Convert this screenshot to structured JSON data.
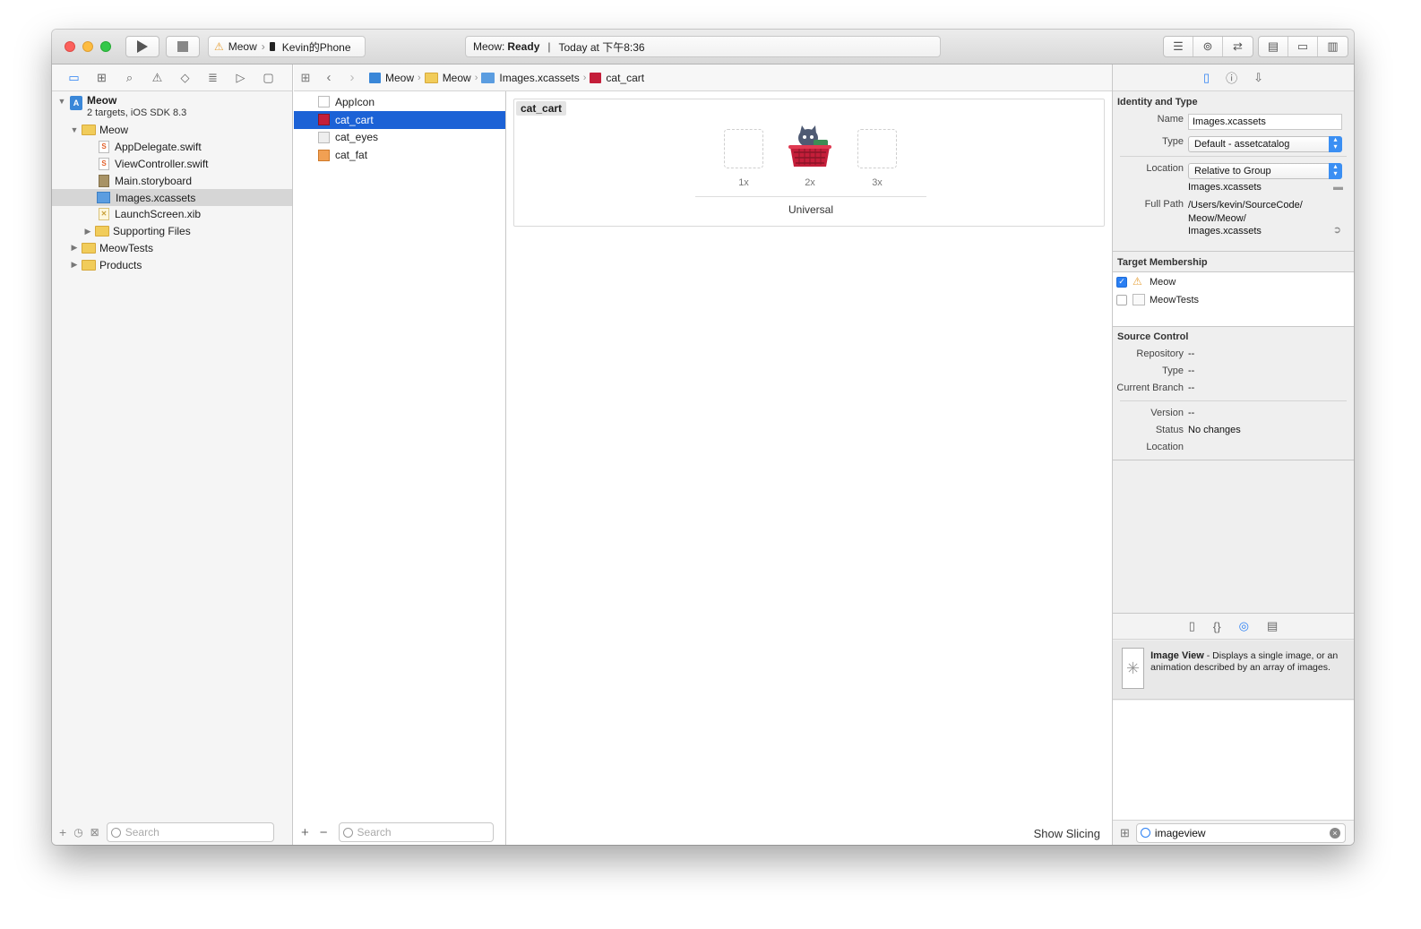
{
  "toolbar": {
    "scheme_target": "Meow",
    "scheme_device": "Kevin的Phone",
    "activity_app": "Meow:",
    "activity_status": "Ready",
    "activity_time": "Today at 下午8:36"
  },
  "navigator": {
    "project_name": "Meow",
    "project_subtitle": "2 targets, iOS SDK 8.3",
    "items": [
      {
        "label": "Meow",
        "type": "folder"
      },
      {
        "label": "AppDelegate.swift",
        "type": "swift"
      },
      {
        "label": "ViewController.swift",
        "type": "swift"
      },
      {
        "label": "Main.storyboard",
        "type": "storyboard"
      },
      {
        "label": "Images.xcassets",
        "type": "xcassets"
      },
      {
        "label": "LaunchScreen.xib",
        "type": "xib"
      },
      {
        "label": "Supporting Files",
        "type": "folder"
      },
      {
        "label": "MeowTests",
        "type": "folder"
      },
      {
        "label": "Products",
        "type": "folder"
      }
    ],
    "search_placeholder": "Search"
  },
  "assets": {
    "items": [
      "AppIcon",
      "cat_cart",
      "cat_eyes",
      "cat_fat"
    ],
    "selected": "cat_cart",
    "search_placeholder": "Search"
  },
  "jumpbar": {
    "crumbs": [
      "Meow",
      "Meow",
      "Images.xcassets",
      "cat_cart"
    ]
  },
  "editor": {
    "set_name": "cat_cart",
    "slots": [
      "1x",
      "2x",
      "3x"
    ],
    "device": "Universal",
    "show_slicing": "Show Slicing"
  },
  "inspector": {
    "identity_header": "Identity and Type",
    "name_label": "Name",
    "name_value": "Images.xcassets",
    "type_label": "Type",
    "type_value": "Default - assetcatalog",
    "location_label": "Location",
    "location_value": "Relative to Group",
    "location_file": "Images.xcassets",
    "fullpath_label": "Full Path",
    "fullpath_value_1": "/Users/kevin/SourceCode/",
    "fullpath_value_2": "Meow/Meow/",
    "fullpath_value_3": "Images.xcassets",
    "target_header": "Target Membership",
    "targets": [
      {
        "name": "Meow",
        "checked": true
      },
      {
        "name": "MeowTests",
        "checked": false
      }
    ],
    "source_header": "Source Control",
    "repository_label": "Repository",
    "repository_value": "--",
    "sc_type_label": "Type",
    "sc_type_value": "--",
    "branch_label": "Current Branch",
    "branch_value": "--",
    "version_label": "Version",
    "version_value": "--",
    "status_label": "Status",
    "status_value": "No changes",
    "sc_location_label": "Location"
  },
  "library": {
    "item_title": "Image View",
    "item_desc": " - Displays a single image, or an animation described by an array of images.",
    "search_value": "imageview"
  },
  "colors": {
    "selection_blue": "#1c62d6",
    "accent_blue": "#2a7ff3"
  }
}
